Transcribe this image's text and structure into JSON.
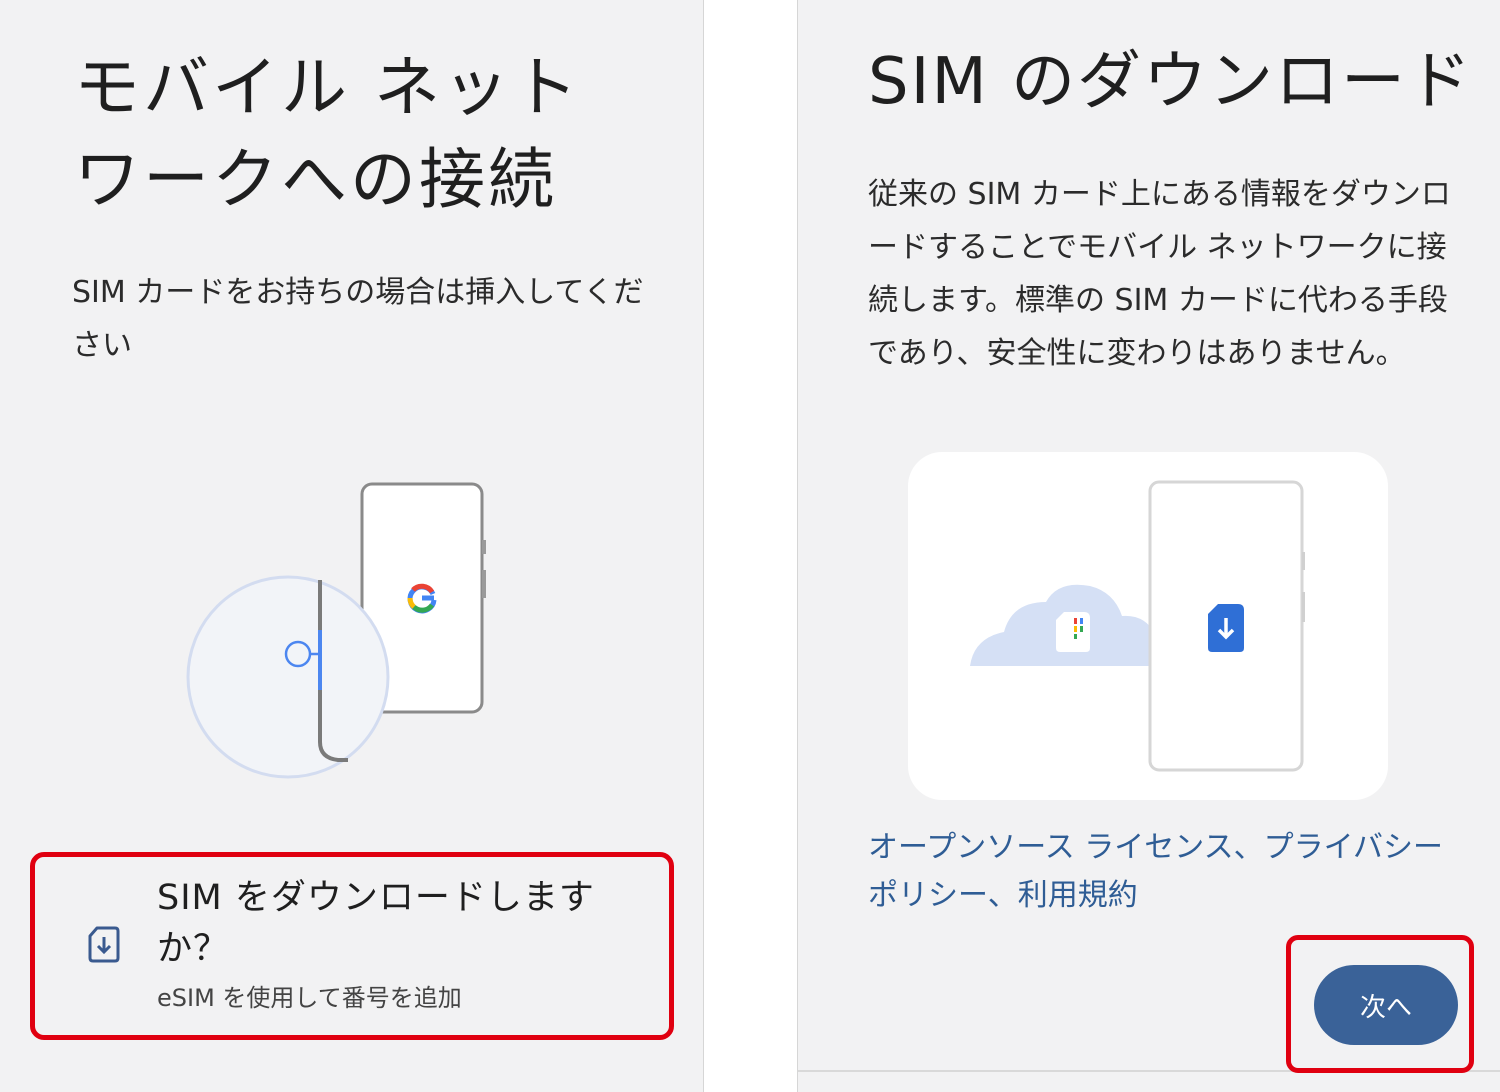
{
  "left_screen": {
    "title": "モバイル ネットワークへの接続",
    "description": "SIM カードをお持ちの場合は挿入してください",
    "illustration": {
      "logo_letter": "G",
      "icon_names": [
        "phone-icon",
        "sim-tray-icon",
        "google-logo-icon"
      ]
    },
    "esim_option": {
      "title": "SIM をダウンロードしますか？",
      "subtitle": "eSIM を使用して番号を追加",
      "icon": "sim-download-icon"
    }
  },
  "right_screen": {
    "title": "SIM のダウンロード",
    "description": "従来の SIM カード上にある情報をダウンロードすることでモバイル ネットワークに接続します。標準の SIM カードに代わる手段であり、安全性に変わりはありません。",
    "illustration": {
      "icon_names": [
        "cloud-icon",
        "sim-card-icon",
        "phone-icon",
        "sim-download-icon"
      ]
    },
    "legal": {
      "open_source": "オープンソース ライセンス",
      "sep1": "、",
      "privacy": "プライバシー ポリシー",
      "sep2": "、",
      "terms": "利用規約"
    },
    "next_button": "次へ"
  },
  "colors": {
    "screen_bg": "#f2f2f3",
    "highlight": "#e00010",
    "link": "#2f5d95",
    "button": "#3a6298",
    "google_blue": "#4285f4",
    "google_red": "#ea4335",
    "google_yellow": "#fbbc05",
    "google_green": "#34a853"
  }
}
